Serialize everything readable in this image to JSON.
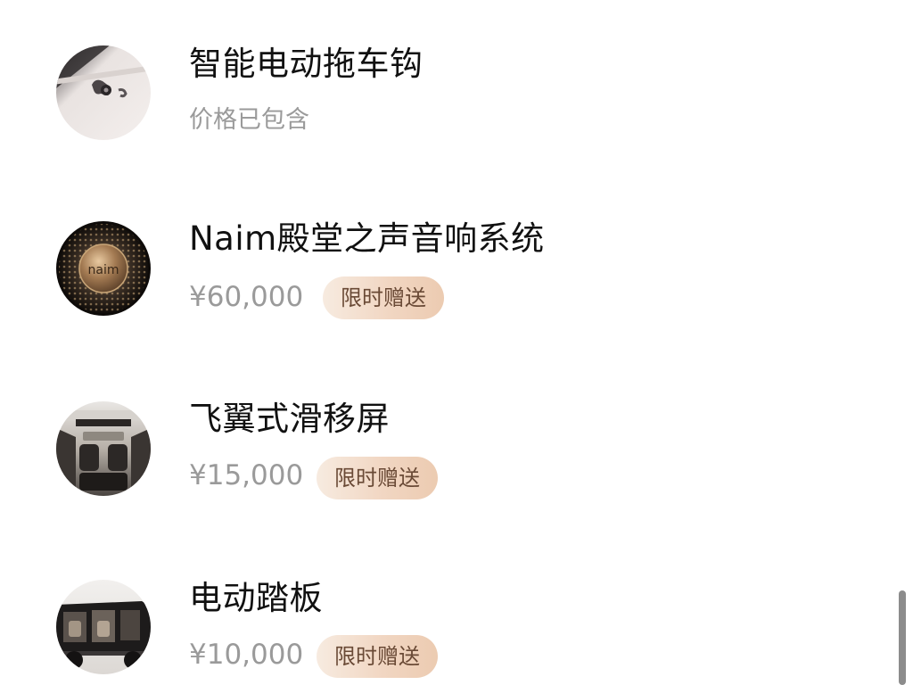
{
  "options": [
    {
      "name": "智能电动拖车钩",
      "note": "价格已包含",
      "image_icon": "tow-hook-image"
    },
    {
      "name": "Naim殿堂之声音响系统",
      "price": "¥60,000",
      "badge": "限时赠送",
      "image_icon": "naim-speaker-image",
      "logo_text": "naim"
    },
    {
      "name": "飞翼式滑移屏",
      "price": "¥15,000",
      "badge": "限时赠送",
      "image_icon": "sliding-screen-image"
    },
    {
      "name": "电动踏板",
      "price": "¥10,000",
      "badge": "限时赠送",
      "image_icon": "power-step-image"
    }
  ],
  "colors": {
    "title": "#111111",
    "muted": "#9a9a9a",
    "badge_text": "#6a4a36",
    "badge_bg_start": "#f7ebe0",
    "badge_bg_end": "#eccbb1",
    "scrollbar": "#8c8c8c"
  }
}
